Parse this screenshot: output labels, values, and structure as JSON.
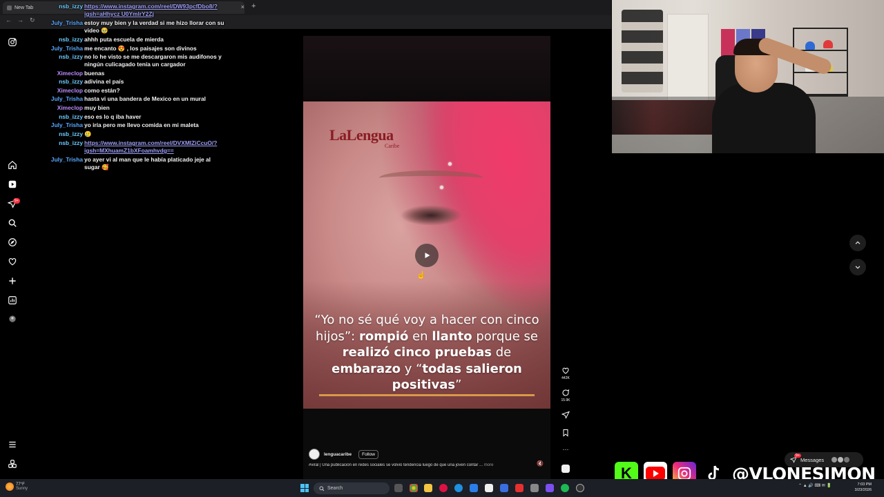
{
  "browser": {
    "tab_title": "New Tab",
    "close_glyph": "×",
    "new_tab_glyph": "+",
    "address_overlay": "https://www.instagram.com/reel/DW93pcfDbo8/?igsh=aHhycz..."
  },
  "sidebar": {
    "icons": [
      "instagram-logo-icon",
      "home-icon",
      "reels-icon",
      "direct-icon",
      "search-icon",
      "explore-icon",
      "notifications-icon",
      "create-icon",
      "dashboard-icon",
      "profile-icon",
      "menu-icon",
      "meta-icon"
    ],
    "direct_badge": "9+"
  },
  "chat": {
    "messages": [
      {
        "user": "nsb_izzy",
        "color": "#6ecbff",
        "text": "https://www.instagram.com/reel/DW93pcfDbo8/?igsh=aHhycz U0YmlrY2Zj",
        "link": true
      },
      {
        "user": "July_Trisha",
        "color": "#5aa9ff",
        "text": "estoy muy bien y la verdad si me hizo llorar con su video 🥹"
      },
      {
        "user": "nsb_izzy",
        "color": "#6ecbff",
        "text": "ahhh puta escuela de mierda"
      },
      {
        "user": "July_Trisha",
        "color": "#5aa9ff",
        "text": "me encanto 😍 , los paisajes son divinos"
      },
      {
        "user": "nsb_izzy",
        "color": "#6ecbff",
        "text": "no lo he visto se me descargaron mis audifonos y ningún culicagado tenía un cargador"
      },
      {
        "user": "Ximeclop",
        "color": "#b98bff",
        "text": "buenas"
      },
      {
        "user": "nsb_izzy",
        "color": "#6ecbff",
        "text": "adivina el país"
      },
      {
        "user": "Ximeclop",
        "color": "#b98bff",
        "text": "como están?"
      },
      {
        "user": "July_Trisha",
        "color": "#5aa9ff",
        "text": "hasta vi una bandera de Mexico en un mural"
      },
      {
        "user": "Ximeclop",
        "color": "#b98bff",
        "text": "muy bien"
      },
      {
        "user": "nsb_izzy",
        "color": "#6ecbff",
        "text": "eso es lo q iba haver"
      },
      {
        "user": "July_Trisha",
        "color": "#5aa9ff",
        "text": "yo iría pero me llevo comida en mi maleta"
      },
      {
        "user": "nsb_izzy",
        "color": "#6ecbff",
        "text": "🥲"
      },
      {
        "user": "nsb_izzy",
        "color": "#6ecbff",
        "text": "https://www.instagram.com/reel/DVXMIZiCcuO/?igsh=MXhuamZ1bXFoamhvdg==",
        "link": true
      },
      {
        "user": "July_Trisha",
        "color": "#5aa9ff",
        "text": "yo ayer vi al man que le había platicado jeje al sugar 🥰"
      }
    ]
  },
  "reel": {
    "logo_main": "LaLengua",
    "logo_sub": "Caribe",
    "caption_parts": [
      {
        "t": "“Yo no sé qué voy a hacer con cinco hijos”: ",
        "b": false
      },
      {
        "t": "rompió",
        "b": true
      },
      {
        "t": " en ",
        "b": false
      },
      {
        "t": "llanto",
        "b": true
      },
      {
        "t": " porque se ",
        "b": false
      },
      {
        "t": "realizó cinco pruebas",
        "b": true
      },
      {
        "t": " de ",
        "b": false
      },
      {
        "t": "embarazo",
        "b": true
      },
      {
        "t": " y “",
        "b": false
      },
      {
        "t": "todas salieron positivas",
        "b": true
      },
      {
        "t": "”",
        "b": false
      }
    ],
    "like_count": "442K",
    "comment_count": "15.9K",
    "more_glyph": "···",
    "author": "lenguacaribe",
    "follow_label": "Follow",
    "description": "#viral | Una publicación en redes sociales se volvió tendencia luego de que una joven contar ...",
    "more_label": "more"
  },
  "messages_pill": {
    "label": "Messages",
    "badge": "9+"
  },
  "socials": {
    "handle": "@VLONESIMON",
    "kick_glyph": "K"
  },
  "taskbar": {
    "weather_temp": "77°F",
    "weather_desc": "Sunny",
    "search_placeholder": "Search",
    "time": "7:03 PM",
    "date": "3/23/2026"
  },
  "colors": {
    "accent_red": "#ff3040",
    "kick_green": "#53fc18",
    "youtube_red": "#ff0000",
    "caption_underline": "#d89a4a"
  }
}
